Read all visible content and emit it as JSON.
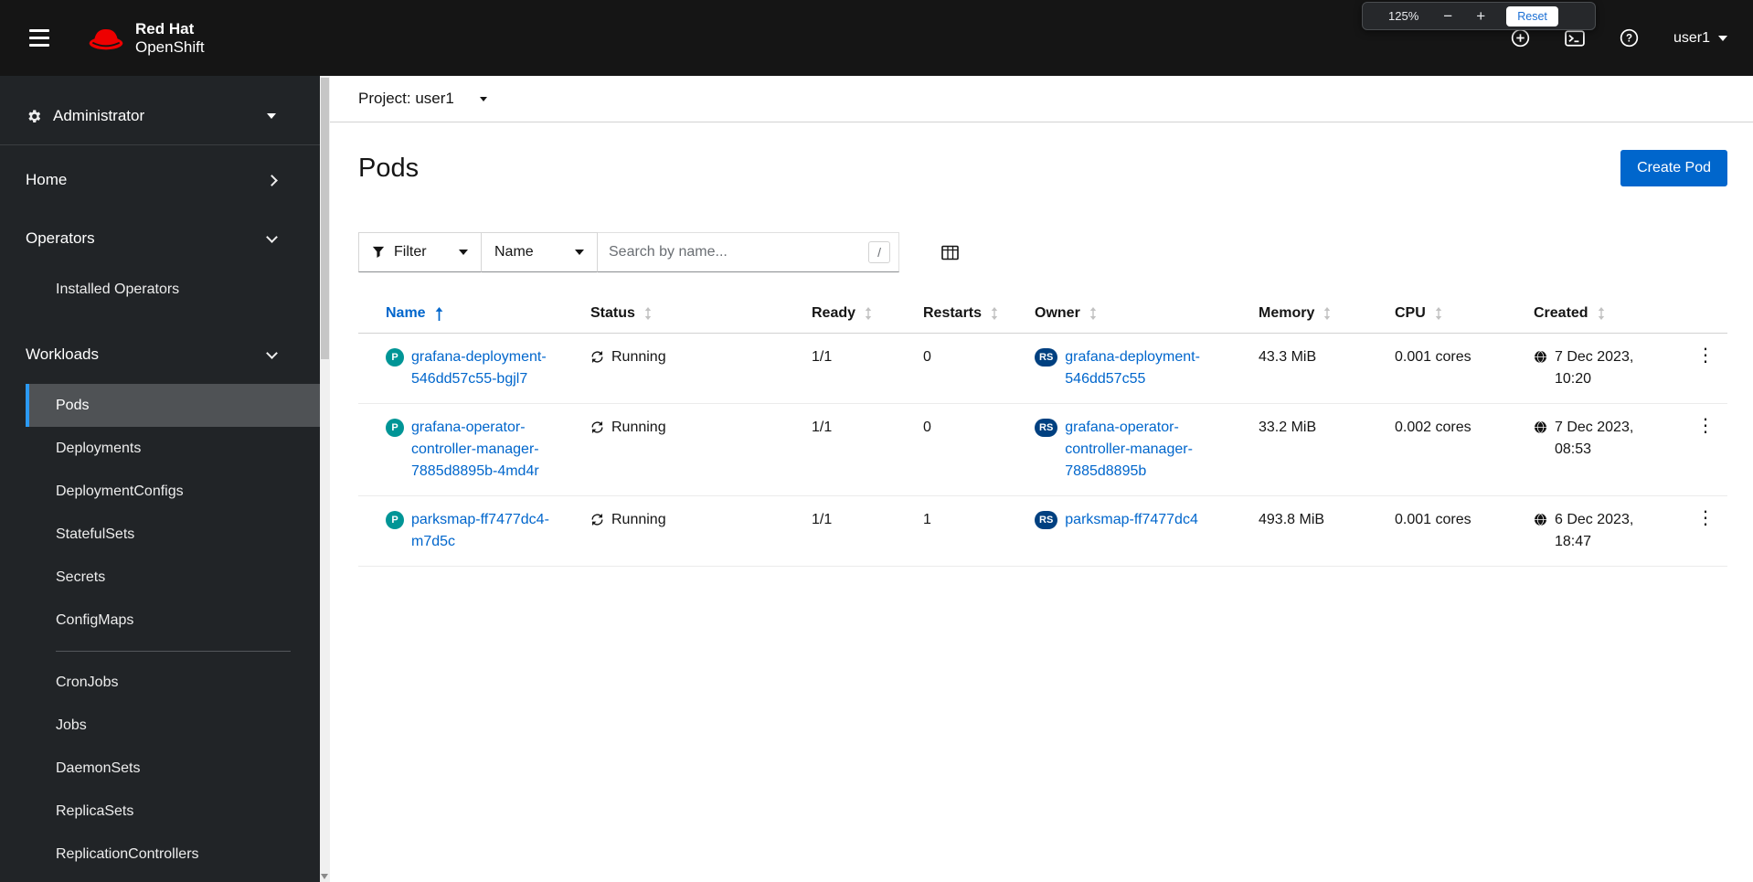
{
  "colors": {
    "accent_blue": "#0066cc",
    "masthead_bg": "#151515",
    "sidebar_bg": "#212427",
    "nav_current_highlight": "#4f5255",
    "nav_current_border": "#2b9af3",
    "pod_badge": "#009596",
    "replicaset_badge": "#004080",
    "brand_red": "#ee0000"
  },
  "icons": {
    "kebab": "⋮"
  },
  "zoom_popup": {
    "level": "125%",
    "zoom_out": "−",
    "zoom_in": "+",
    "reset": "Reset"
  },
  "header": {
    "brand_line1": "Red Hat",
    "brand_line2": "OpenShift",
    "user": "user1"
  },
  "sidebar": {
    "perspective": "Administrator",
    "sections": [
      {
        "label": "Home"
      },
      {
        "label": "Operators",
        "children": [
          "Installed Operators"
        ]
      },
      {
        "label": "Workloads",
        "children": [
          "Pods",
          "Deployments",
          "DeploymentConfigs",
          "StatefulSets",
          "Secrets",
          "ConfigMaps",
          "CronJobs",
          "Jobs",
          "DaemonSets",
          "ReplicaSets",
          "ReplicationControllers"
        ]
      }
    ]
  },
  "main": {
    "project_label": "Project: user1",
    "page_title": "Pods",
    "create_button": "Create Pod",
    "toolbar": {
      "filter_label": "Filter",
      "attribute_label": "Name",
      "search_placeholder": "Search by name...",
      "shortcut_hint": "/"
    },
    "table": {
      "columns": [
        "Name",
        "Status",
        "Ready",
        "Restarts",
        "Owner",
        "Memory",
        "CPU",
        "Created"
      ],
      "rows": [
        {
          "badge": "P",
          "name": "grafana-deployment-546dd57c55-bgjl7",
          "status": "Running",
          "ready": "1/1",
          "restarts": "0",
          "owner_badge": "RS",
          "owner": "grafana-deployment-546dd57c55",
          "memory": "43.3 MiB",
          "cpu": "0.001 cores",
          "created": "7 Dec 2023, 10:20"
        },
        {
          "badge": "P",
          "name": "grafana-operator-controller-manager-7885d8895b-4md4r",
          "status": "Running",
          "ready": "1/1",
          "restarts": "0",
          "owner_badge": "RS",
          "owner": "grafana-operator-controller-manager-7885d8895b",
          "memory": "33.2 MiB",
          "cpu": "0.002 cores",
          "created": "7 Dec 2023, 08:53"
        },
        {
          "badge": "P",
          "name": "parksmap-ff7477dc4-m7d5c",
          "status": "Running",
          "ready": "1/1",
          "restarts": "1",
          "owner_badge": "RS",
          "owner": "parksmap-ff7477dc4",
          "memory": "493.8 MiB",
          "cpu": "0.001 cores",
          "created": "6 Dec 2023, 18:47"
        }
      ]
    }
  }
}
